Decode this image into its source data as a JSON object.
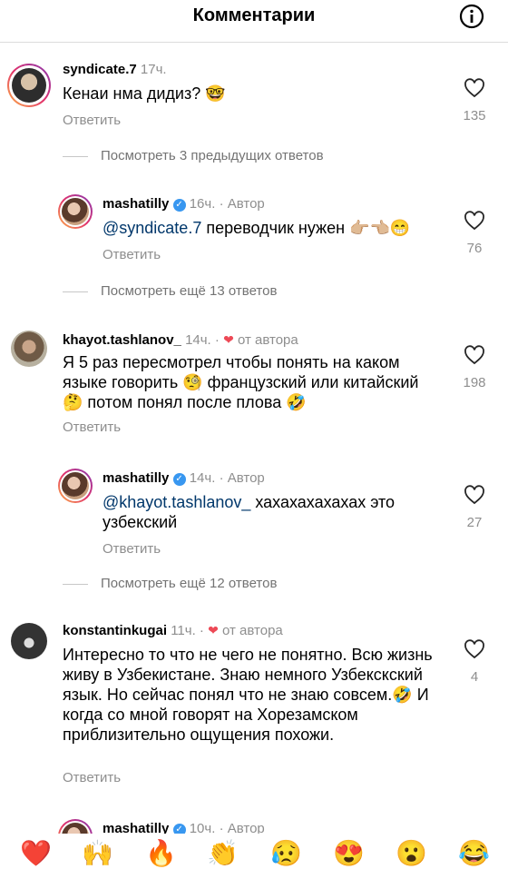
{
  "header": {
    "title": "Комментарии"
  },
  "common": {
    "reply_label": "Ответить"
  },
  "comments": [
    {
      "username": "syndicate.7",
      "time": "17ч.",
      "text": "Кенаи нма дидиз? 🤓",
      "likes": "135"
    },
    {
      "view_more": "Посмотреть 3 предыдущих ответов"
    },
    {
      "username": "mashatilly",
      "time": "16ч.",
      "tag": "· Автор",
      "mention": "@syndicate.7",
      "text": " переводчик нужен 👉🏼👈🏼😁",
      "likes": "76"
    },
    {
      "view_more": "Посмотреть ещё 13 ответов"
    },
    {
      "username": "khayot.tashlanov_",
      "time": "14ч.",
      "tag": "от автора",
      "text": "Я 5 раз пересмотрел чтобы понять на каком языке говорить 🧐 французский или китайский 🤔 потом понял после плова 🤣",
      "likes": "198"
    },
    {
      "username": "mashatilly",
      "time": "14ч.",
      "tag": "· Автор",
      "mention": "@khayot.tashlanov_",
      "text": " хахахахахахах это узбекский",
      "likes": "27"
    },
    {
      "view_more": "Посмотреть ещё 12 ответов"
    },
    {
      "username": "konstantinkugai",
      "time": "11ч.",
      "tag": "от автора",
      "text": "Интересно то что не чего не понятно. Всю жизнь живу в Узбекистане. Знаю немного Узбекскский язык. Но сейчас понял что не знаю совсем.🤣 И когда со мной говорят на Хорезамском приблизительно ощущения похожи.",
      "likes": "4"
    },
    {
      "username": "mashatilly",
      "time": "10ч.",
      "tag": "· Автор"
    }
  ],
  "reactions": [
    "❤️",
    "🙌",
    "🔥",
    "👏",
    "😥",
    "😍",
    "😮",
    "😂"
  ]
}
